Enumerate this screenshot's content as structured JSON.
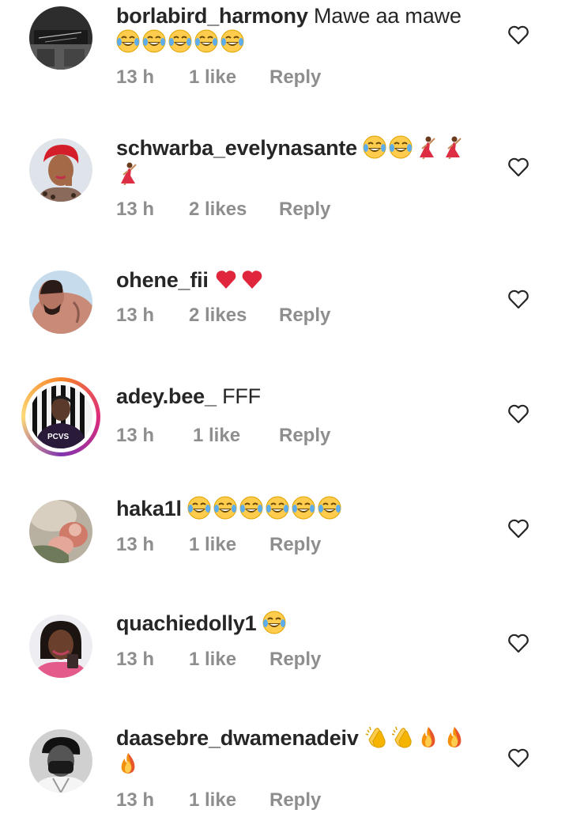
{
  "comments": [
    {
      "username": "borlabird_harmony",
      "text": "Mawe aa mawe",
      "emojis": [
        "face-with-tears-of-joy",
        "face-with-tears-of-joy",
        "face-with-tears-of-joy",
        "face-with-tears-of-joy",
        "face-with-tears-of-joy"
      ],
      "time": "13 h",
      "likes": "1 like",
      "reply": "Reply"
    },
    {
      "username": "schwarba_evelynasante",
      "text": "",
      "emojis": [
        "face-with-tears-of-joy",
        "face-with-tears-of-joy",
        "woman-dancing",
        "woman-dancing",
        "woman-dancing"
      ],
      "time": "13 h",
      "likes": "2 likes",
      "reply": "Reply"
    },
    {
      "username": "ohene_fii",
      "text": "",
      "emojis": [
        "red-heart",
        "red-heart"
      ],
      "time": "13 h",
      "likes": "2 likes",
      "reply": "Reply"
    },
    {
      "username": "adey.bee_",
      "text": "FFF",
      "emojis": [],
      "time": "13 h",
      "likes": "1 like",
      "reply": "Reply"
    },
    {
      "username": "haka1l",
      "text": "",
      "emojis": [
        "face-with-tears-of-joy",
        "face-with-tears-of-joy",
        "face-with-tears-of-joy",
        "face-with-tears-of-joy",
        "face-with-tears-of-joy",
        "face-with-tears-of-joy"
      ],
      "time": "13 h",
      "likes": "1 like",
      "reply": "Reply"
    },
    {
      "username": "quachiedolly1",
      "text": "",
      "emojis": [
        "face-with-tears-of-joy"
      ],
      "time": "13 h",
      "likes": "1 like",
      "reply": "Reply"
    },
    {
      "username": "daasebre_dwamenadeiv",
      "text": "",
      "emojis": [
        "clapping-hands",
        "clapping-hands",
        "fire",
        "fire",
        "fire"
      ],
      "time": "13 h",
      "likes": "1 like",
      "reply": "Reply"
    }
  ],
  "avatar_badge_text": "PCVS",
  "colors": {
    "text": "#262626",
    "meta": "#8e8e8e",
    "story_ring": "#dd2a7b"
  },
  "icons": {
    "like": "heart-outline-icon"
  }
}
